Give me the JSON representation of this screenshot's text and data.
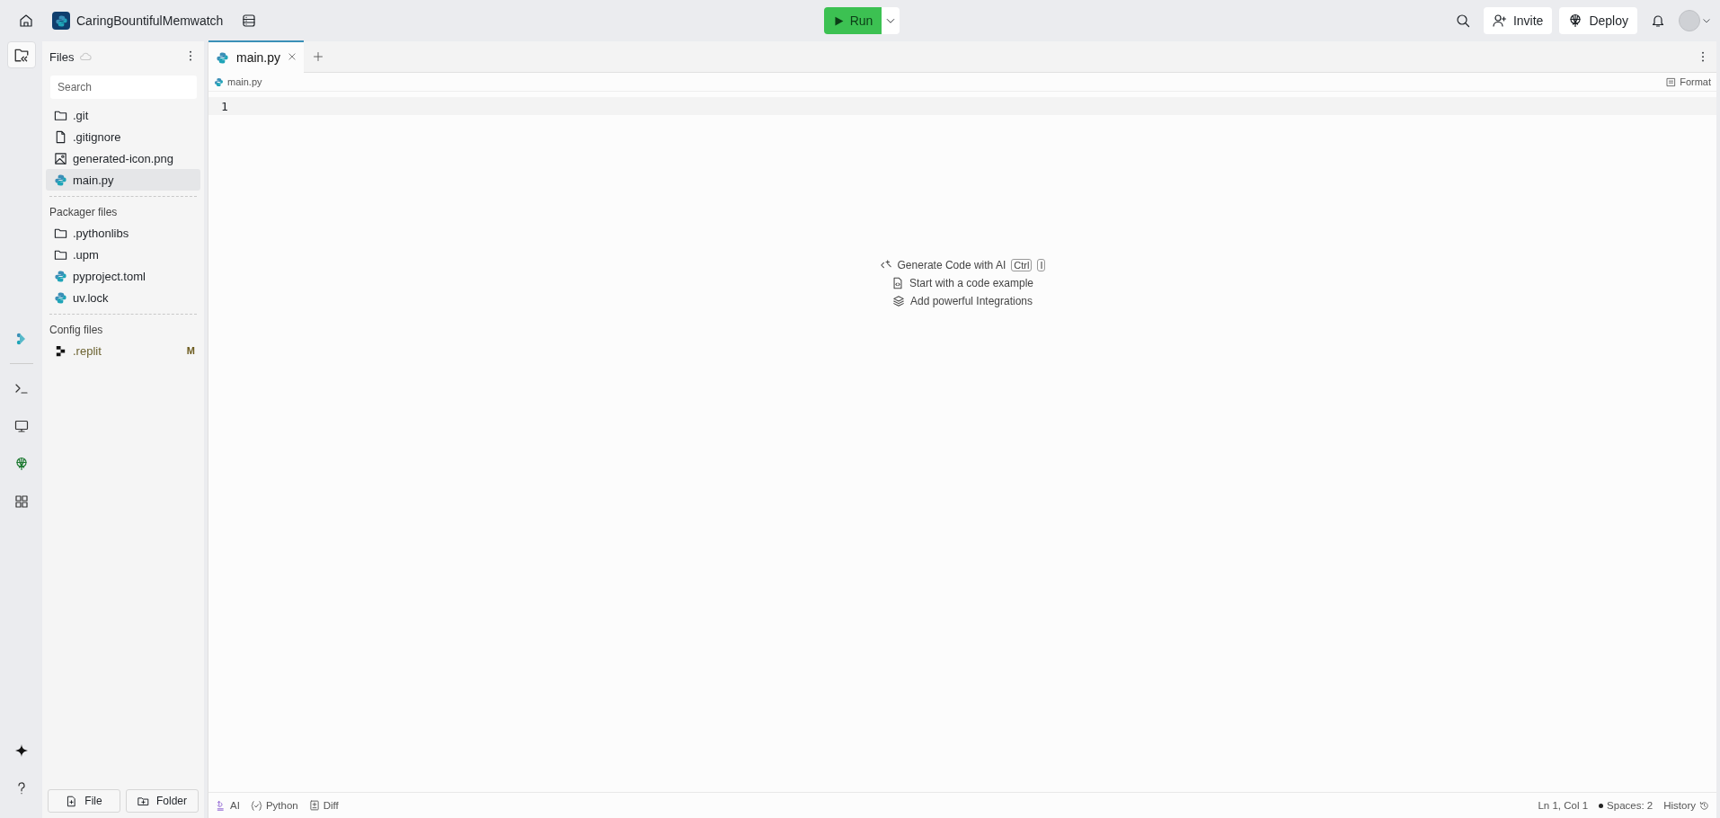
{
  "project": {
    "name": "CaringBountifulMemwatch"
  },
  "run_button": {
    "label": "Run"
  },
  "header_actions": [
    {
      "kind": "invite",
      "label": "Invite"
    },
    {
      "kind": "deploy",
      "label": "Deploy"
    }
  ],
  "rail": [
    {
      "kind": "files",
      "selected": true
    },
    {
      "kind": "agent",
      "selected": false
    },
    {
      "kind": "shell",
      "selected": false
    },
    {
      "kind": "preview",
      "selected": false
    },
    {
      "kind": "deploy",
      "selected": false
    },
    {
      "kind": "apps",
      "selected": false
    }
  ],
  "files_panel": {
    "title": "Files",
    "search": {
      "placeholder": "Search"
    },
    "groups": [
      {
        "items": [
          {
            "name": ".git",
            "kind": "folder",
            "selected": false,
            "modified": false
          },
          {
            "name": ".gitignore",
            "kind": "file",
            "selected": false,
            "modified": false
          },
          {
            "name": "generated-icon.png",
            "kind": "image",
            "selected": false,
            "modified": false
          },
          {
            "name": "main.py",
            "kind": "python",
            "selected": true,
            "modified": false
          }
        ]
      },
      {
        "title": "Packager files",
        "items": [
          {
            "name": ".pythonlibs",
            "kind": "folder",
            "selected": false,
            "modified": false
          },
          {
            "name": ".upm",
            "kind": "folder",
            "selected": false,
            "modified": false
          },
          {
            "name": "pyproject.toml",
            "kind": "python",
            "selected": false,
            "modified": false
          },
          {
            "name": "uv.lock",
            "kind": "python",
            "selected": false,
            "modified": false
          }
        ]
      },
      {
        "title": "Config files",
        "items": [
          {
            "name": ".replit",
            "kind": "replit",
            "selected": false,
            "modified": true,
            "badge": "M"
          }
        ]
      }
    ],
    "footer_buttons": [
      {
        "kind": "file",
        "label": "File"
      },
      {
        "kind": "folder",
        "label": "Folder"
      }
    ]
  },
  "editor": {
    "tabs": [
      {
        "label": "main.py",
        "selected": true
      }
    ],
    "breadcrumb": "main.py",
    "format_label": "Format",
    "line_numbers": [
      "1"
    ],
    "hints": [
      {
        "kind": "ai",
        "label": "Generate Code with AI",
        "keys": [
          "Ctrl",
          "I"
        ]
      },
      {
        "kind": "example",
        "label": "Start with a code example"
      },
      {
        "kind": "integrations",
        "label": "Add powerful Integrations"
      }
    ]
  },
  "status_bar": {
    "items": [
      {
        "kind": "ai",
        "label": "AI"
      },
      {
        "kind": "python",
        "label": "Python"
      },
      {
        "kind": "diff",
        "label": "Diff"
      }
    ],
    "position": "Ln 1, Col 1",
    "spaces": "Spaces: 2",
    "history": "History"
  }
}
